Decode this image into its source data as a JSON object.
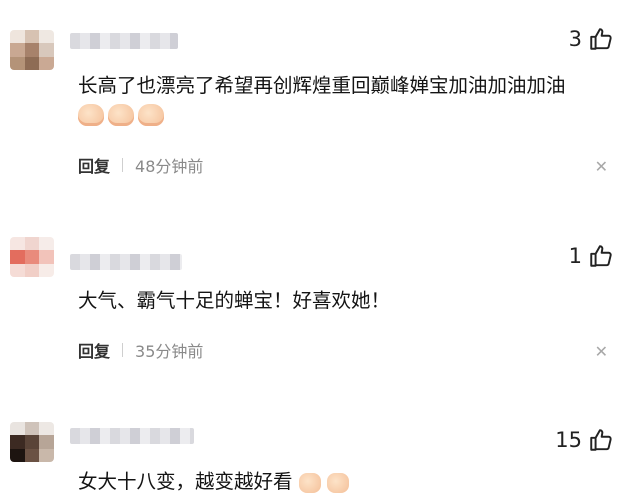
{
  "comments": [
    {
      "likes": "3",
      "text": "长高了也漂亮了希望再创辉煌重回巅峰婵宝加油加油加油",
      "emoji_count": 3,
      "reply_label": "回复",
      "time": "48分钟前",
      "close_icon": "✕"
    },
    {
      "likes": "1",
      "text": "大气、霸气十足的蝉宝！好喜欢她！",
      "reply_label": "回复",
      "time": "35分钟前",
      "close_icon": "✕"
    },
    {
      "likes": "15",
      "text": "女大十八变，越变越好看"
    }
  ],
  "icons": {
    "like": "thumbs-up-icon",
    "close": "close-icon",
    "avatar": "blurred-avatar"
  },
  "colors": {
    "text": "#141414",
    "time": "#8a8a8a",
    "close": "#a8a8a8"
  }
}
